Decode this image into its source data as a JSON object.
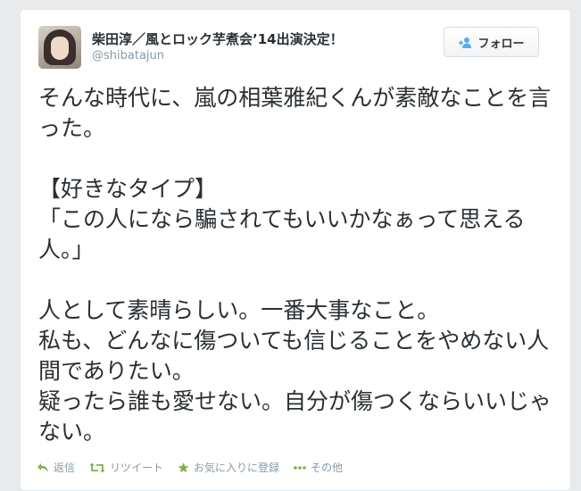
{
  "tweet": {
    "display_name": "柴田淳／風とロック芋煮会’14出演決定！",
    "screen_name": "@shibatajun",
    "text": "そんな時代に、嵐の相葉雅紀くんが素敵なことを言った。\n\n【好きなタイプ】\n「この人になら騙されてもいいかなぁって思える人。」\n\n人として素晴らしい。一番大事なこと。\n私も、どんなに傷ついても信じることをやめない人間でありたい。\n疑ったら誰も愛せない。自分が傷つくならいいじゃない。"
  },
  "follow_button": {
    "label": "フォロー",
    "icon": "follow-user-icon"
  },
  "actions": [
    {
      "label": "返信",
      "icon": "reply-icon"
    },
    {
      "label": "リツイート",
      "icon": "retweet-icon"
    },
    {
      "label": "お気に入りに登録",
      "icon": "star-icon"
    },
    {
      "label": "その他",
      "icon": "more-icon"
    }
  ],
  "colors": {
    "action_icon": "#7eb14c",
    "follow_icon": "#55acee",
    "text": "#292f33",
    "muted": "#8899a6"
  }
}
